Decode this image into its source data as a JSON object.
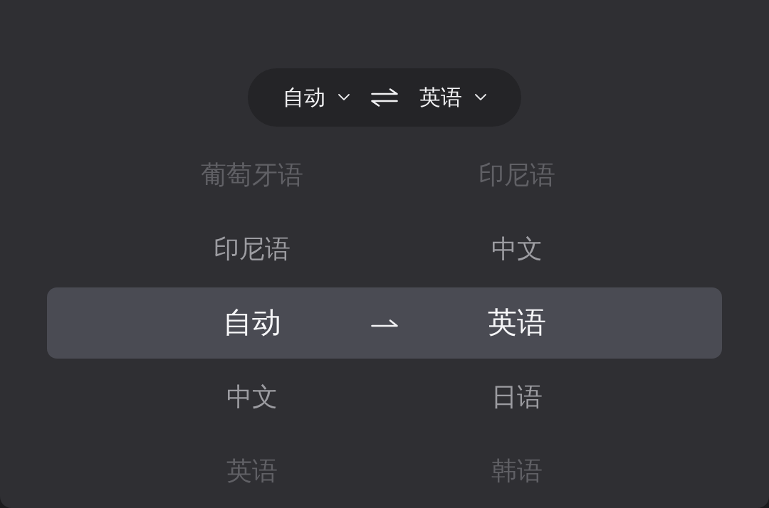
{
  "language_bar": {
    "source": "自动",
    "target": "英语"
  },
  "picker": {
    "source_languages": [
      {
        "label": "葡萄牙语",
        "selected": false
      },
      {
        "label": "印尼语",
        "selected": false
      },
      {
        "label": "自动",
        "selected": true
      },
      {
        "label": "中文",
        "selected": false
      },
      {
        "label": "英语",
        "selected": false
      }
    ],
    "target_languages": [
      {
        "label": "印尼语",
        "selected": false
      },
      {
        "label": "中文",
        "selected": false
      },
      {
        "label": "英语",
        "selected": true
      },
      {
        "label": "日语",
        "selected": false
      },
      {
        "label": "韩语",
        "selected": false
      }
    ]
  }
}
